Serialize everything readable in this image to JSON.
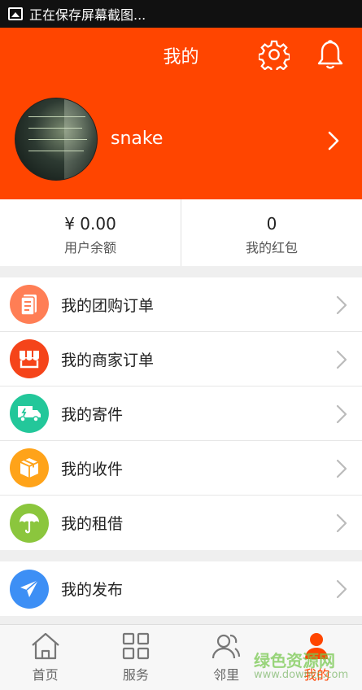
{
  "status_bar": {
    "text": "正在保存屏幕截图..."
  },
  "header": {
    "title": "我的"
  },
  "profile": {
    "username": "snake",
    "avatar_text": [
      "我曾经失落失望",
      "失掉所有方向",
      "直到看见平凡才",
      "是唯一的答案"
    ]
  },
  "wallet": [
    {
      "value": "¥ 0.00",
      "label": "用户余额"
    },
    {
      "value": "0",
      "label": "我的红包"
    }
  ],
  "menu_group1": [
    {
      "label": "我的团购订单",
      "icon": "document-icon",
      "color": "#ff7e55"
    },
    {
      "label": "我的商家订单",
      "icon": "store-icon",
      "color": "#f5441a"
    },
    {
      "label": "我的寄件",
      "icon": "truck-icon",
      "color": "#23c79a"
    },
    {
      "label": "我的收件",
      "icon": "box-icon",
      "color": "#ffa319"
    },
    {
      "label": "我的租借",
      "icon": "umbrella-icon",
      "color": "#8bc63d"
    }
  ],
  "menu_group2": [
    {
      "label": "我的发布",
      "icon": "paper-plane-icon",
      "color": "#3d8ff5"
    }
  ],
  "tabs": [
    {
      "label": "首页",
      "icon": "home-icon"
    },
    {
      "label": "服务",
      "icon": "grid-icon"
    },
    {
      "label": "邻里",
      "icon": "people-icon"
    },
    {
      "label": "我的",
      "icon": "person-icon",
      "active": true
    }
  ],
  "watermark": {
    "line1": "绿色资源网",
    "line2": "www.downcc.com"
  },
  "colors": {
    "accent": "#ff4500"
  }
}
